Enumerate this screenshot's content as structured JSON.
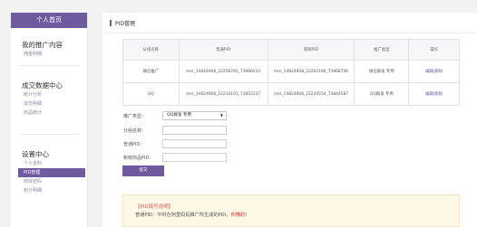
{
  "sidebar": {
    "home_label": "个人首页",
    "groups": [
      {
        "title": "我的推广内容",
        "items": [
          "佣金明细"
        ]
      },
      {
        "title": "成交数据中心",
        "items": [
          "统计分析",
          "成交明细",
          "商品统计"
        ]
      },
      {
        "title": "设置中心",
        "items": [
          "个人资料",
          "PID管理",
          "修改密码",
          "积分明细"
        ]
      }
    ],
    "active_item": "PID管理"
  },
  "page": {
    "title": "PID管理"
  },
  "table": {
    "headers": [
      "分组名称",
      "普通PID",
      "新鲜PID",
      "推广类型",
      "操作"
    ],
    "rows": [
      [
        "微信推广",
        "mm_14824908_22256781_73980233",
        "mm_14824908_22262180_73968736",
        "微信群发 专用"
      ],
      [
        "QQ",
        "mm_14824908_22214103_73852237",
        "mm_14824908_22220554_73844587",
        "QQ群发 专用"
      ]
    ],
    "op_edit": "编辑",
    "op_sep": "|",
    "op_delete": "删除"
  },
  "form": {
    "type_label": "推广类型：",
    "type_value": "QQ群发 专用",
    "type_caret": "▼",
    "group_label": "分组名称：",
    "pid_label": "普通PID：",
    "new_pid_label": "新鲜商品PID：",
    "submit_label": "提交"
  },
  "notice": {
    "title": "【PID填写说明】",
    "text_prefix": "普通PID：平时在阿里妈妈推广所生成的PID，",
    "text_highlight": "你懂的！"
  }
}
